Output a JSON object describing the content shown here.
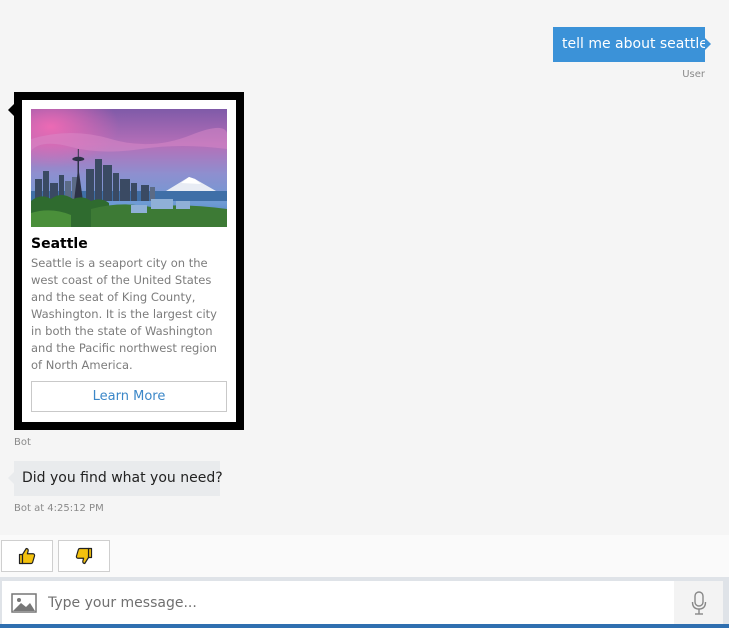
{
  "conversation": {
    "user_message": "tell me about seattle",
    "user_sender": "User",
    "hero_card": {
      "image_alt": "Seattle skyline with Space Needle and Mount Rainier",
      "title": "Seattle",
      "text": "Seattle is a seaport city on the west coast of the United States and the seat of King County, Washington. It is the largest city in both the state of Washington and the Pacific northwest region of North America.",
      "button_label": "Learn More"
    },
    "bot_sender": "Bot",
    "bot_message": "Did you find what you need?",
    "bot_timestamp": "Bot at 4:25:12 PM"
  },
  "feedback": {
    "thumbs_up_icon": "thumbs-up-icon",
    "thumbs_down_icon": "thumbs-down-icon"
  },
  "input": {
    "placeholder": "Type your message...",
    "value": "",
    "upload_icon": "image-upload-icon",
    "mic_icon": "microphone-icon"
  },
  "colors": {
    "user_bubble": "#3b92d8",
    "bot_bubble": "#e9ebed",
    "card_border": "#000000",
    "link_blue": "#3b87c8",
    "icon_gold": "#f4c20d"
  }
}
